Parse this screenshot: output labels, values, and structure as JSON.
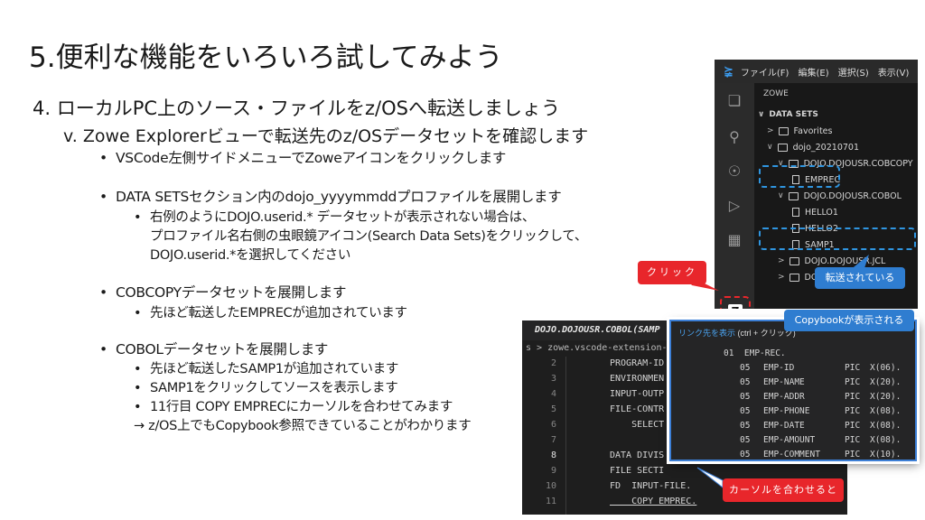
{
  "title": "5.便利な機能をいろいろ試してみよう",
  "heading1": "4.  ローカルPC上のソース・ファイルをz/OSへ転送しましょう",
  "heading2": "v.   Zowe Explorerビューで転送先のz/OSデータセットを確認します",
  "bullets": {
    "b1": "VSCode左側サイドメニューでZoweアイコンをクリックします",
    "b2": "DATA SETSセクション内のdojo_yyyymmddプロファイルを展開します",
    "b2_sub1": "右例のようにDOJO.userid.* データセットが表示されない場合は、",
    "b2_sub2": "プロファイル名右側の虫眼鏡アイコン(Search Data Sets)をクリックして、",
    "b2_sub3": "DOJO.userid.*を選択してください",
    "b3": "COBCOPYデータセットを展開します",
    "b3_sub1": "先ほど転送したEMPRECが追加されています",
    "b4": "COBOLデータセットを展開します",
    "b4_sub1": "先ほど転送したSAMP1が追加されています",
    "b4_sub2": "SAMP1をクリックしてソースを表示します",
    "b4_sub3": "11行目 COPY EMPRECにカーソルを合わせてみます",
    "b4_sub4": "→ z/OS上でもCopybook参照できていることがわかります",
    "dot": "•"
  },
  "vscode": {
    "menu": [
      "ファイル(F)",
      "編集(E)",
      "選択(S)",
      "表示(V)"
    ],
    "tree_header": "ZOWE",
    "section": "DATA SETS",
    "items": {
      "favorites": "Favorites",
      "profile": "dojo_20210701",
      "cobcopy": "DOJO.DOJOUSR.COBCOPY",
      "emprec": "EMPREC",
      "cobol": "DOJO.DOJOUSR.COBOL",
      "hello1": "HELLO1",
      "hello2": "HELLO2",
      "samp1": "SAMP1",
      "jcl": "DOJO.DOJOUSR.JCL",
      "other": "DOJO"
    }
  },
  "editor": {
    "tab": "DOJO.DOJOUSR.COBOL(SAMP",
    "breadcrumb": "s > zowe.vscode-extension-for-zow",
    "lines": [
      {
        "n": "2",
        "code": "PROGRAM-ID"
      },
      {
        "n": "3",
        "code": "ENVIRONMEN"
      },
      {
        "n": "4",
        "code": "INPUT-OUTP"
      },
      {
        "n": "5",
        "code": "FILE-CONTR"
      },
      {
        "n": "6",
        "code": "    SELECT"
      },
      {
        "n": "7",
        "code": ""
      },
      {
        "n": "8",
        "code": "DATA DIVIS"
      },
      {
        "n": "9",
        "code": "FILE SECTI"
      },
      {
        "n": "10",
        "code": "FD  INPUT-FILE."
      },
      {
        "n": "11",
        "code": "    COPY EMPREC."
      }
    ]
  },
  "popup": {
    "link": "リンク先を表示",
    "hint": "(ctrl + クリック)",
    "rec": "01  EMP-REC.",
    "fields": [
      {
        "lvl": "05",
        "name": "EMP-ID",
        "pic": "PIC",
        "fmt": "X(06)."
      },
      {
        "lvl": "05",
        "name": "EMP-NAME",
        "pic": "PIC",
        "fmt": "X(20)."
      },
      {
        "lvl": "05",
        "name": "EMP-ADDR",
        "pic": "PIC",
        "fmt": "X(20)."
      },
      {
        "lvl": "05",
        "name": "EMP-PHONE",
        "pic": "PIC",
        "fmt": "X(08)."
      },
      {
        "lvl": "05",
        "name": "EMP-DATE",
        "pic": "PIC",
        "fmt": "X(08)."
      },
      {
        "lvl": "05",
        "name": "EMP-AMOUNT",
        "pic": "PIC",
        "fmt": "X(08)."
      },
      {
        "lvl": "05",
        "name": "EMP-COMMENT",
        "pic": "PIC",
        "fmt": "X(10)."
      }
    ]
  },
  "callouts": {
    "click": "クリック",
    "transferred": "転送されている",
    "copybook": "Copybookが表示される",
    "cursor": "カーソルを合わせると"
  },
  "colors": {
    "red": "#e8262b",
    "blue": "#2f7dd0",
    "dash_blue": "#2f95e0"
  }
}
